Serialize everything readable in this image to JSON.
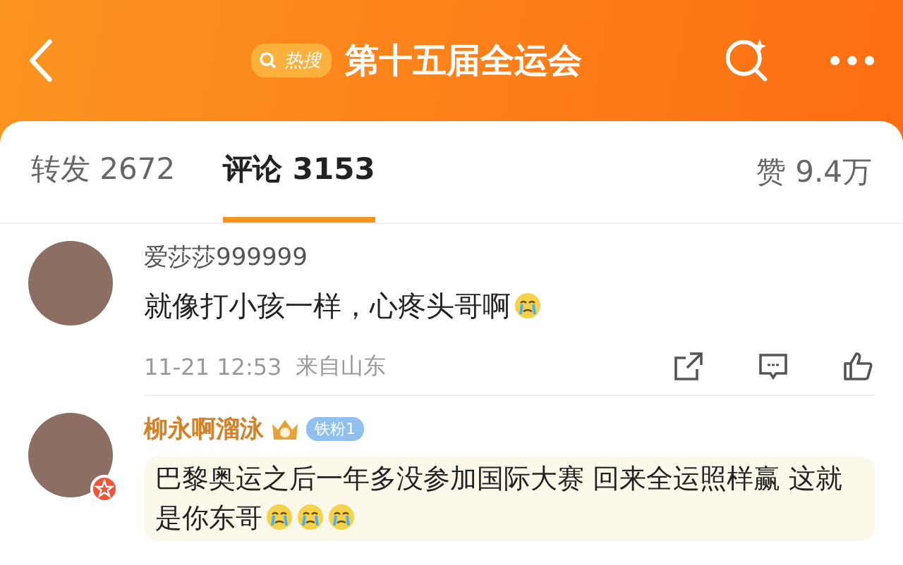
{
  "header": {
    "hot_badge": "热搜",
    "title": "第十五届全运会"
  },
  "tabs": [
    {
      "label": "转发",
      "count": "2672",
      "selected": false
    },
    {
      "label": "评论",
      "count": "3153",
      "selected": true
    }
  ],
  "likes": {
    "label": "赞",
    "count": "9.4万"
  },
  "comments": [
    {
      "user": "爱莎莎999999",
      "kind": "plain",
      "text": "就像打小孩一样，心疼头哥啊",
      "emojis": [
        {
          "kind": "crying"
        }
      ],
      "time": "11-21 12:53",
      "location": "来自山东"
    },
    {
      "user": "柳永啊溜泳",
      "kind": "fan",
      "fan_badge": "铁粉1",
      "text": "巴黎奥运之后一年多没参加国际大赛 回来全运照样赢 这就是你东哥",
      "emojis": [
        {
          "kind": "crying"
        },
        {
          "kind": "crying"
        },
        {
          "kind": "crying"
        }
      ]
    }
  ]
}
